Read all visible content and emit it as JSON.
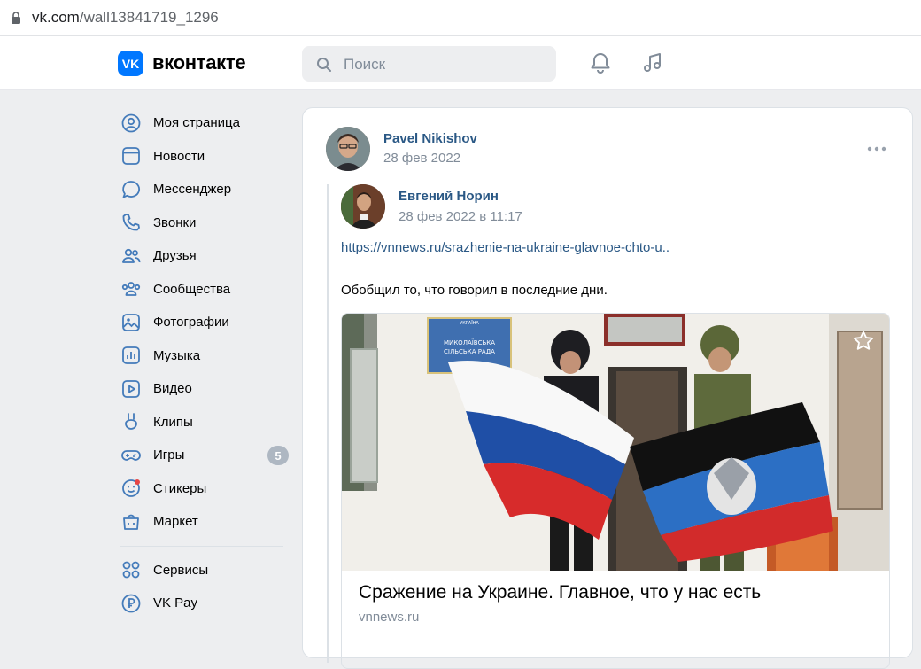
{
  "browser": {
    "url_host": "vk.com",
    "url_path": "/wall13841719_1296"
  },
  "header": {
    "logo_mark": "VK",
    "logo_text": "вконтакте",
    "search_placeholder": "Поиск",
    "icons": [
      "bell-icon",
      "music-icon"
    ]
  },
  "sidebar": {
    "items": [
      {
        "label": "Моя страница",
        "icon": "user-circle-icon"
      },
      {
        "label": "Новости",
        "icon": "news-icon"
      },
      {
        "label": "Мессенджер",
        "icon": "message-icon"
      },
      {
        "label": "Звонки",
        "icon": "phone-icon"
      },
      {
        "label": "Друзья",
        "icon": "friends-icon"
      },
      {
        "label": "Сообщества",
        "icon": "communities-icon"
      },
      {
        "label": "Фотографии",
        "icon": "photo-icon"
      },
      {
        "label": "Музыка",
        "icon": "music-bars-icon"
      },
      {
        "label": "Видео",
        "icon": "video-icon"
      },
      {
        "label": "Клипы",
        "icon": "clips-icon"
      },
      {
        "label": "Игры",
        "icon": "gamepad-icon",
        "badge": "5"
      },
      {
        "label": "Стикеры",
        "icon": "sticker-icon"
      },
      {
        "label": "Маркет",
        "icon": "market-bag-icon"
      }
    ],
    "extra_items": [
      {
        "label": "Сервисы",
        "icon": "services-icon"
      },
      {
        "label": "VK Pay",
        "icon": "vkpay-icon"
      }
    ]
  },
  "post": {
    "author": "Pavel Nikishov",
    "date": "28 фев 2022",
    "repost": {
      "author": "Евгений Норин",
      "date": "28 фев 2022 в 11:17",
      "link": "https://vnnews.ru/srazhenie-na-ukraine-glavnoe-chto-u..",
      "text": "Обобщил то, что говорил в последние дни.",
      "attachment": {
        "sign_text": "УКРАЇНА МИКОЛАЇВСЬКА СІЛЬСЬКА РАДА",
        "title": "Сражение на Украине. Главное, что у нас есть",
        "host": "vnnews.ru"
      }
    }
  },
  "colors": {
    "accent": "#0077ff",
    "link": "#2a5885",
    "muted": "#818c99",
    "page_bg": "#edeef0"
  }
}
